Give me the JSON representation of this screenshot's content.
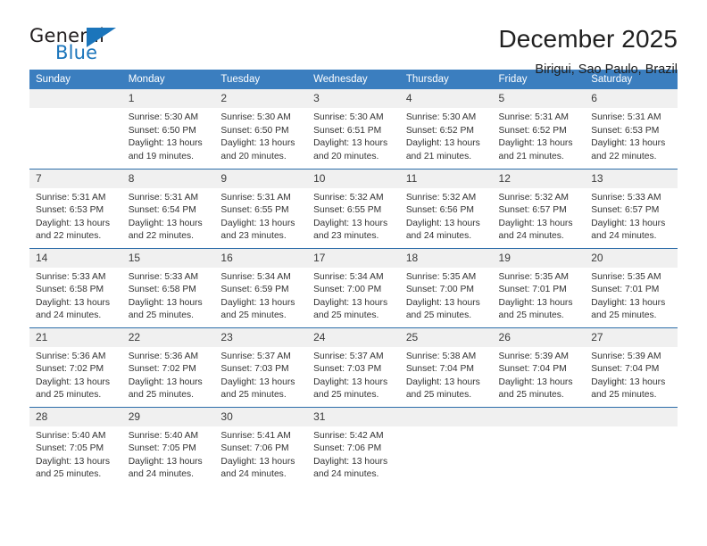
{
  "logo": {
    "primary_text": "General",
    "secondary_text": "Blue",
    "triangle_icon": "triangle-icon",
    "brand_color": "#1b75bb"
  },
  "header": {
    "title": "December 2025",
    "subtitle": "Birigui, Sao Paulo, Brazil"
  },
  "calendar": {
    "header_color": "#3b7ebf",
    "weekdays": [
      "Sunday",
      "Monday",
      "Tuesday",
      "Wednesday",
      "Thursday",
      "Friday",
      "Saturday"
    ],
    "labels": {
      "sunrise": "Sunrise:",
      "sunset": "Sunset:",
      "daylight": "Daylight:"
    },
    "weeks": [
      [
        {
          "day": ""
        },
        {
          "day": "1",
          "sunrise": "Sunrise: 5:30 AM",
          "sunset": "Sunset: 6:50 PM",
          "daylight": "Daylight: 13 hours and 19 minutes."
        },
        {
          "day": "2",
          "sunrise": "Sunrise: 5:30 AM",
          "sunset": "Sunset: 6:50 PM",
          "daylight": "Daylight: 13 hours and 20 minutes."
        },
        {
          "day": "3",
          "sunrise": "Sunrise: 5:30 AM",
          "sunset": "Sunset: 6:51 PM",
          "daylight": "Daylight: 13 hours and 20 minutes."
        },
        {
          "day": "4",
          "sunrise": "Sunrise: 5:30 AM",
          "sunset": "Sunset: 6:52 PM",
          "daylight": "Daylight: 13 hours and 21 minutes."
        },
        {
          "day": "5",
          "sunrise": "Sunrise: 5:31 AM",
          "sunset": "Sunset: 6:52 PM",
          "daylight": "Daylight: 13 hours and 21 minutes."
        },
        {
          "day": "6",
          "sunrise": "Sunrise: 5:31 AM",
          "sunset": "Sunset: 6:53 PM",
          "daylight": "Daylight: 13 hours and 22 minutes."
        }
      ],
      [
        {
          "day": "7",
          "sunrise": "Sunrise: 5:31 AM",
          "sunset": "Sunset: 6:53 PM",
          "daylight": "Daylight: 13 hours and 22 minutes."
        },
        {
          "day": "8",
          "sunrise": "Sunrise: 5:31 AM",
          "sunset": "Sunset: 6:54 PM",
          "daylight": "Daylight: 13 hours and 22 minutes."
        },
        {
          "day": "9",
          "sunrise": "Sunrise: 5:31 AM",
          "sunset": "Sunset: 6:55 PM",
          "daylight": "Daylight: 13 hours and 23 minutes."
        },
        {
          "day": "10",
          "sunrise": "Sunrise: 5:32 AM",
          "sunset": "Sunset: 6:55 PM",
          "daylight": "Daylight: 13 hours and 23 minutes."
        },
        {
          "day": "11",
          "sunrise": "Sunrise: 5:32 AM",
          "sunset": "Sunset: 6:56 PM",
          "daylight": "Daylight: 13 hours and 24 minutes."
        },
        {
          "day": "12",
          "sunrise": "Sunrise: 5:32 AM",
          "sunset": "Sunset: 6:57 PM",
          "daylight": "Daylight: 13 hours and 24 minutes."
        },
        {
          "day": "13",
          "sunrise": "Sunrise: 5:33 AM",
          "sunset": "Sunset: 6:57 PM",
          "daylight": "Daylight: 13 hours and 24 minutes."
        }
      ],
      [
        {
          "day": "14",
          "sunrise": "Sunrise: 5:33 AM",
          "sunset": "Sunset: 6:58 PM",
          "daylight": "Daylight: 13 hours and 24 minutes."
        },
        {
          "day": "15",
          "sunrise": "Sunrise: 5:33 AM",
          "sunset": "Sunset: 6:58 PM",
          "daylight": "Daylight: 13 hours and 25 minutes."
        },
        {
          "day": "16",
          "sunrise": "Sunrise: 5:34 AM",
          "sunset": "Sunset: 6:59 PM",
          "daylight": "Daylight: 13 hours and 25 minutes."
        },
        {
          "day": "17",
          "sunrise": "Sunrise: 5:34 AM",
          "sunset": "Sunset: 7:00 PM",
          "daylight": "Daylight: 13 hours and 25 minutes."
        },
        {
          "day": "18",
          "sunrise": "Sunrise: 5:35 AM",
          "sunset": "Sunset: 7:00 PM",
          "daylight": "Daylight: 13 hours and 25 minutes."
        },
        {
          "day": "19",
          "sunrise": "Sunrise: 5:35 AM",
          "sunset": "Sunset: 7:01 PM",
          "daylight": "Daylight: 13 hours and 25 minutes."
        },
        {
          "day": "20",
          "sunrise": "Sunrise: 5:35 AM",
          "sunset": "Sunset: 7:01 PM",
          "daylight": "Daylight: 13 hours and 25 minutes."
        }
      ],
      [
        {
          "day": "21",
          "sunrise": "Sunrise: 5:36 AM",
          "sunset": "Sunset: 7:02 PM",
          "daylight": "Daylight: 13 hours and 25 minutes."
        },
        {
          "day": "22",
          "sunrise": "Sunrise: 5:36 AM",
          "sunset": "Sunset: 7:02 PM",
          "daylight": "Daylight: 13 hours and 25 minutes."
        },
        {
          "day": "23",
          "sunrise": "Sunrise: 5:37 AM",
          "sunset": "Sunset: 7:03 PM",
          "daylight": "Daylight: 13 hours and 25 minutes."
        },
        {
          "day": "24",
          "sunrise": "Sunrise: 5:37 AM",
          "sunset": "Sunset: 7:03 PM",
          "daylight": "Daylight: 13 hours and 25 minutes."
        },
        {
          "day": "25",
          "sunrise": "Sunrise: 5:38 AM",
          "sunset": "Sunset: 7:04 PM",
          "daylight": "Daylight: 13 hours and 25 minutes."
        },
        {
          "day": "26",
          "sunrise": "Sunrise: 5:39 AM",
          "sunset": "Sunset: 7:04 PM",
          "daylight": "Daylight: 13 hours and 25 minutes."
        },
        {
          "day": "27",
          "sunrise": "Sunrise: 5:39 AM",
          "sunset": "Sunset: 7:04 PM",
          "daylight": "Daylight: 13 hours and 25 minutes."
        }
      ],
      [
        {
          "day": "28",
          "sunrise": "Sunrise: 5:40 AM",
          "sunset": "Sunset: 7:05 PM",
          "daylight": "Daylight: 13 hours and 25 minutes."
        },
        {
          "day": "29",
          "sunrise": "Sunrise: 5:40 AM",
          "sunset": "Sunset: 7:05 PM",
          "daylight": "Daylight: 13 hours and 24 minutes."
        },
        {
          "day": "30",
          "sunrise": "Sunrise: 5:41 AM",
          "sunset": "Sunset: 7:06 PM",
          "daylight": "Daylight: 13 hours and 24 minutes."
        },
        {
          "day": "31",
          "sunrise": "Sunrise: 5:42 AM",
          "sunset": "Sunset: 7:06 PM",
          "daylight": "Daylight: 13 hours and 24 minutes."
        },
        {
          "day": ""
        },
        {
          "day": ""
        },
        {
          "day": ""
        }
      ]
    ]
  }
}
